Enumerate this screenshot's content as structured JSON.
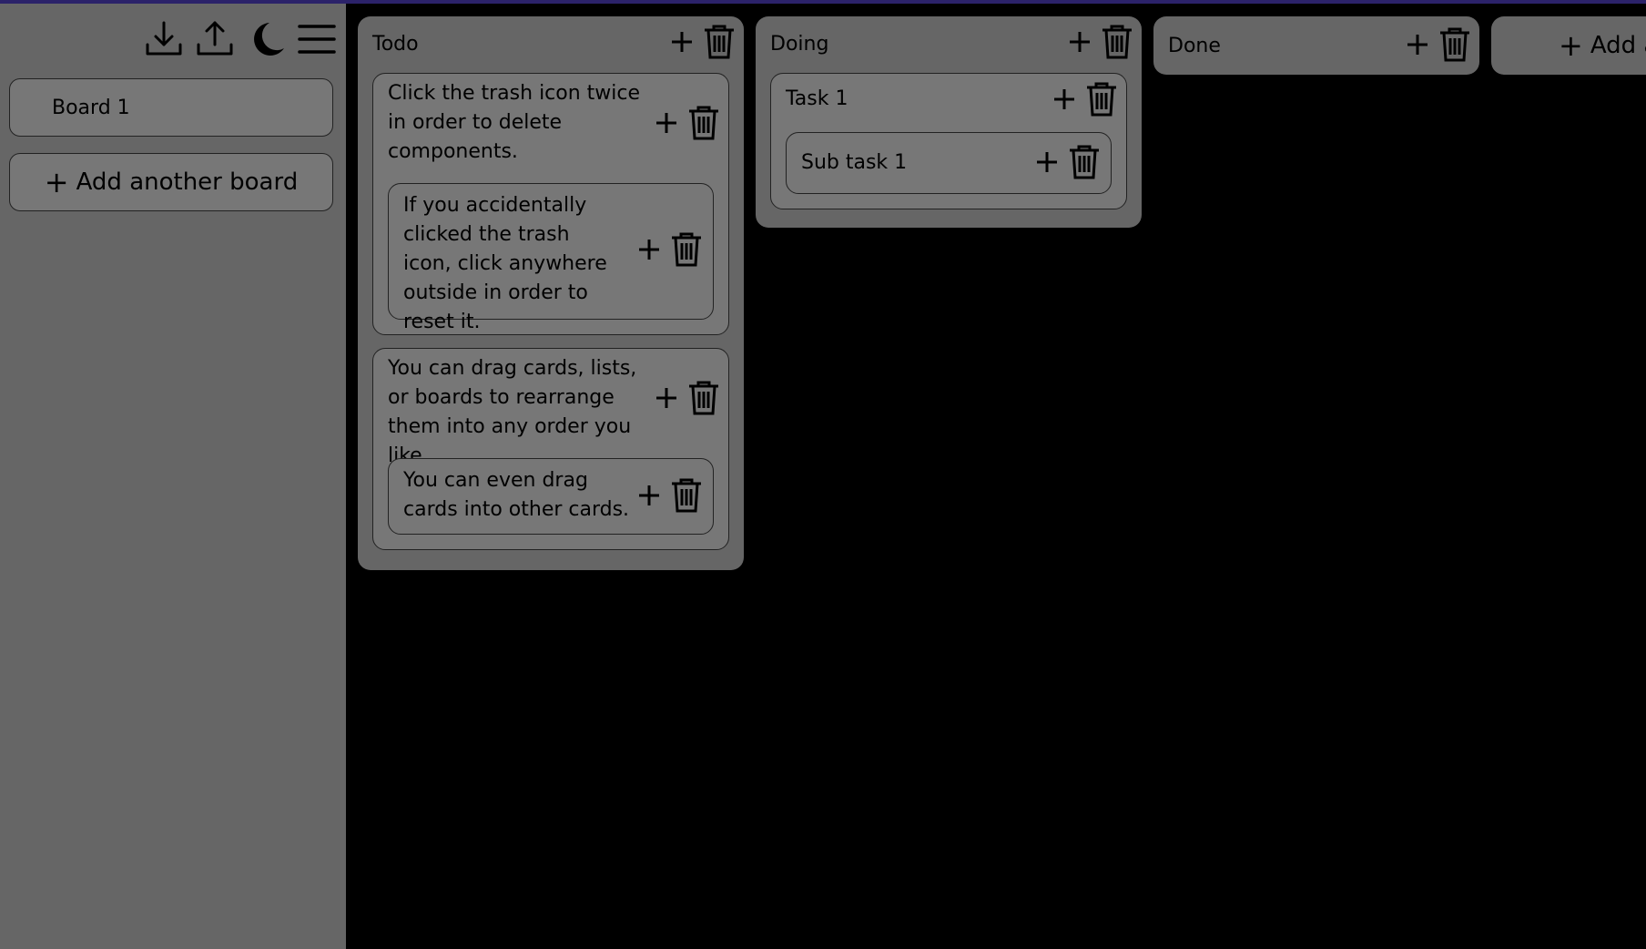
{
  "sidebar": {
    "icons": [
      "download-icon",
      "upload-icon",
      "moon-icon",
      "menu-icon"
    ],
    "boards": [
      {
        "label": "Board 1"
      }
    ],
    "add_board_label": "Add another board"
  },
  "lists": [
    {
      "title": "Todo",
      "cards": [
        {
          "text": "Click the trash icon twice in order to delete components.",
          "children": [
            {
              "text": "If you accidentally clicked the trash icon, click anywhere outside in order to reset it."
            }
          ]
        },
        {
          "text": "You can drag cards, lists, or boards to rearrange them into any order you like.",
          "children": [
            {
              "text": "You can even drag cards into other cards."
            }
          ]
        }
      ]
    },
    {
      "title": "Doing",
      "cards": [
        {
          "text": "Task 1",
          "children": [
            {
              "text": "Sub task 1"
            }
          ]
        }
      ]
    },
    {
      "title": "Done",
      "cards": []
    }
  ],
  "add_list_label": "Add a",
  "colors": {
    "background": "#000000",
    "panel": "#666666",
    "card": "#777777",
    "accent_line": "#2b2269"
  }
}
